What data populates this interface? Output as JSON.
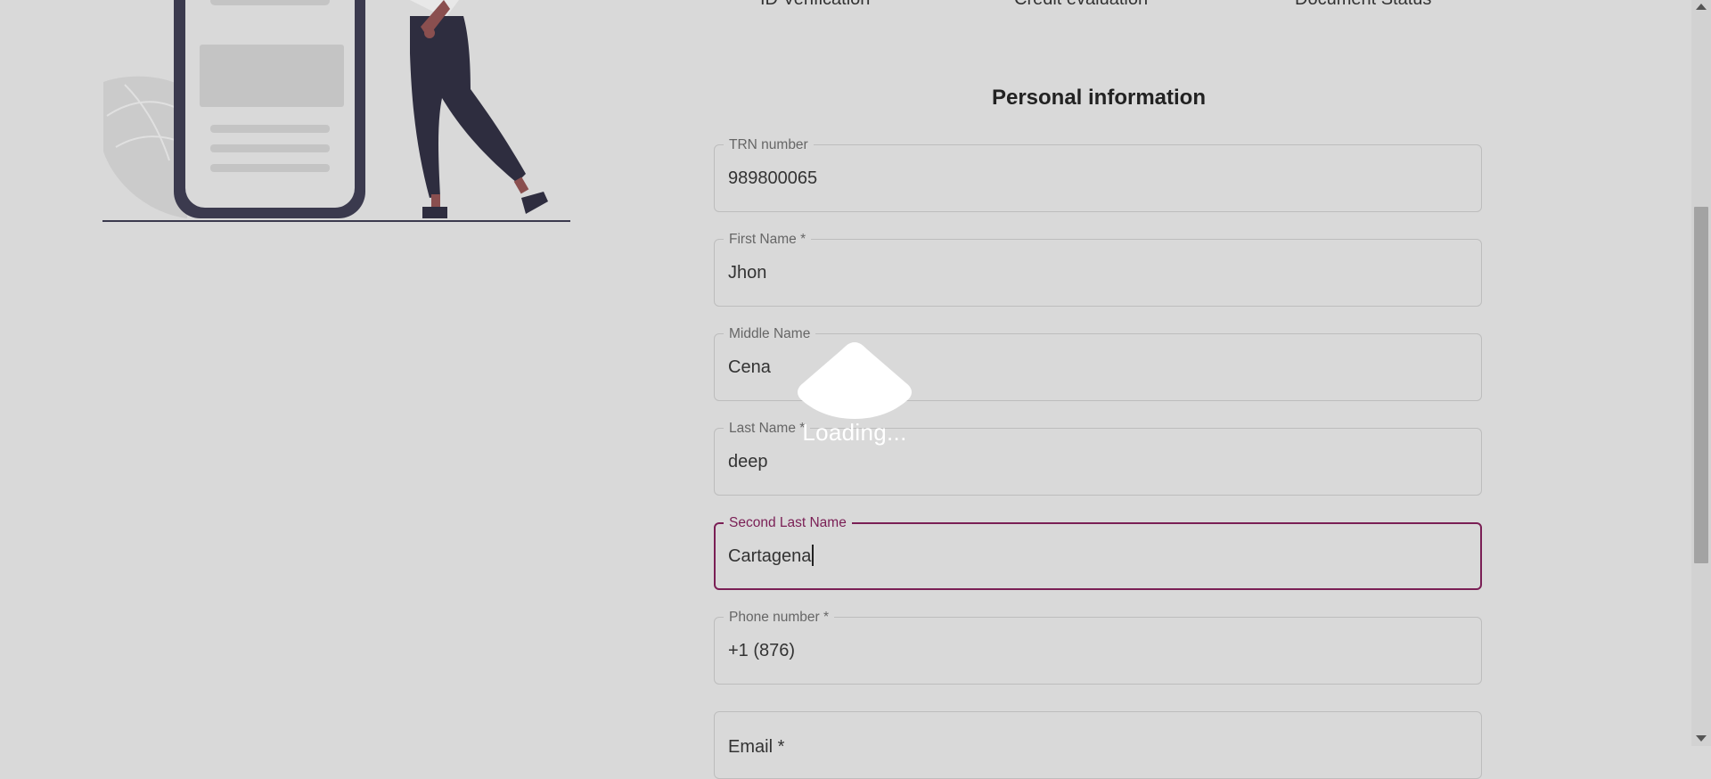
{
  "steps": {
    "id_verification": "ID Verification",
    "credit_evaluation": "Credit evaluation",
    "document_status": "Document Status"
  },
  "section": {
    "title": "Personal information"
  },
  "fields": {
    "trn": {
      "label": "TRN number",
      "value": "989800065"
    },
    "first_name": {
      "label": "First Name *",
      "value": "Jhon"
    },
    "middle_name": {
      "label": "Middle Name",
      "value": "Cena"
    },
    "last_name": {
      "label": "Last Name *",
      "value": "deep"
    },
    "second_last_name": {
      "label": "Second Last Name",
      "value": "Cartagena"
    },
    "phone": {
      "label": "Phone number *",
      "value": "+1 (876)"
    },
    "email": {
      "label": "Email *",
      "value": ""
    }
  },
  "loading": {
    "text": "Loading..."
  },
  "colors": {
    "accent": "#7a1f55",
    "background": "#d9d9d9",
    "border": "#bdbdbd",
    "illustration_dark": "#3b3a4e"
  }
}
